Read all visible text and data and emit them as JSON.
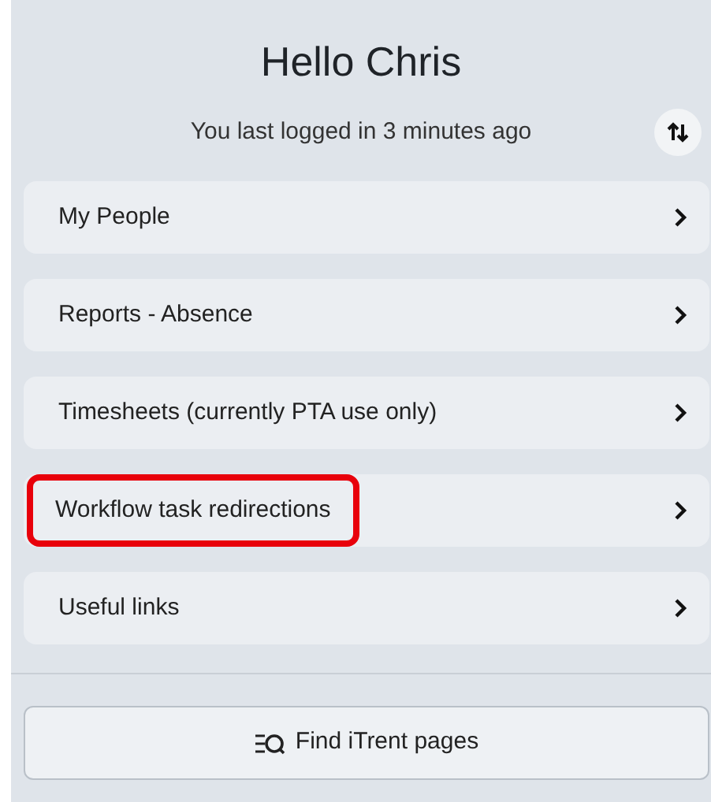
{
  "greeting": "Hello Chris",
  "last_login": "You last logged in 3 minutes ago",
  "menu_items": [
    {
      "label": "My People",
      "highlighted": false
    },
    {
      "label": "Reports - Absence",
      "highlighted": false
    },
    {
      "label": "Timesheets (currently PTA use only)",
      "highlighted": false
    },
    {
      "label": "Workflow task redirections",
      "highlighted": true
    },
    {
      "label": "Useful links",
      "highlighted": false
    }
  ],
  "search_button": {
    "label": "Find iTrent pages"
  }
}
